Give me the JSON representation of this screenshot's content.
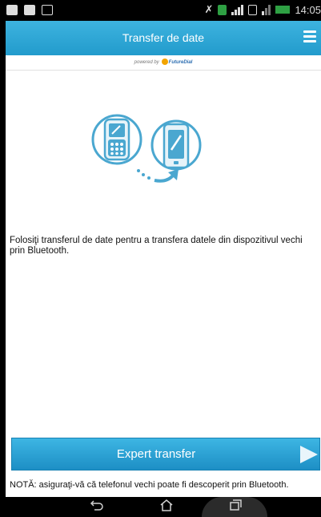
{
  "status_bar": {
    "left_icons": [
      "calendar-icon",
      "document-icon",
      "image-icon"
    ],
    "right_icons": [
      "no-data-icon",
      "notification-icon",
      "signal-icon",
      "sim-2-icon",
      "signal-icon",
      "battery-charging-icon"
    ],
    "time": "14:05",
    "accent": "#2ea043"
  },
  "header": {
    "title": "Transfer de date",
    "menu_icon": "hamburger-menu-icon",
    "background": "#2ba6d6"
  },
  "powered_by": {
    "prefix": "powered by",
    "brand": "FutureDial"
  },
  "illustration": {
    "left_icon": "old-phone-icon",
    "right_icon": "smartphone-icon",
    "connector_icon": "curved-arrow-icon",
    "accent": "#4aa7d0"
  },
  "description": "Folosiţi transferul de date pentru a transfera datele din dispozitivul vechi prin Bluetooth.",
  "expert_button": {
    "label": "Expert transfer",
    "icon": "play-arrow-icon"
  },
  "note": "NOTĂ: asiguraţi-vă că telefonul vechi poate fi descoperit prin Bluetooth.",
  "nav_bar": {
    "back_icon": "back-icon",
    "home_icon": "home-icon",
    "recents_icon": "recent-apps-icon"
  }
}
